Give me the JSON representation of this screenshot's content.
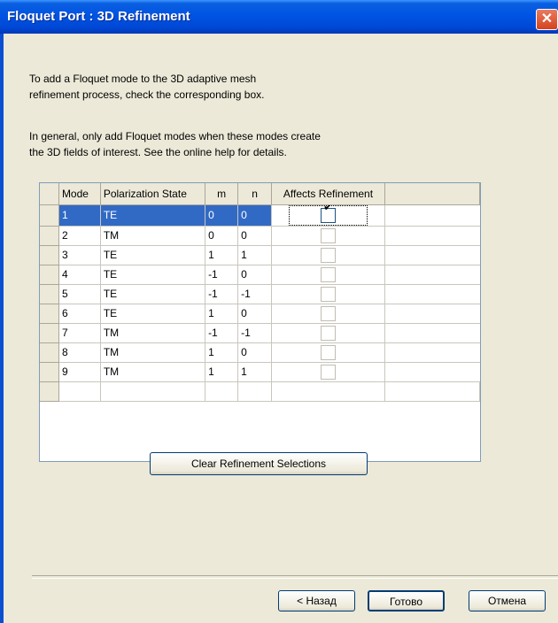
{
  "window": {
    "title": "Floquet Port : 3D Refinement",
    "close_glyph": "✕"
  },
  "intro": {
    "line1": "To add a Floquet mode to the 3D adaptive mesh",
    "line2": "refinement process, check the corresponding box.",
    "line3": "In general, only add Floquet modes when these modes create",
    "line4": "the 3D fields of interest.  See the online help for details."
  },
  "table": {
    "columns": [
      "Mode",
      "Polarization State",
      "m",
      "n",
      "Affects Refinement"
    ],
    "rows": [
      {
        "mode": "1",
        "polarization": "TE",
        "m": "0",
        "n": "0",
        "affects": true,
        "selected": true
      },
      {
        "mode": "2",
        "polarization": "TM",
        "m": "0",
        "n": "0",
        "affects": false,
        "selected": false
      },
      {
        "mode": "3",
        "polarization": "TE",
        "m": "1",
        "n": "1",
        "affects": false,
        "selected": false
      },
      {
        "mode": "4",
        "polarization": "TE",
        "m": "-1",
        "n": "0",
        "affects": false,
        "selected": false
      },
      {
        "mode": "5",
        "polarization": "TE",
        "m": "-1",
        "n": "-1",
        "affects": false,
        "selected": false
      },
      {
        "mode": "6",
        "polarization": "TE",
        "m": "1",
        "n": "0",
        "affects": false,
        "selected": false
      },
      {
        "mode": "7",
        "polarization": "TM",
        "m": "-1",
        "n": "-1",
        "affects": false,
        "selected": false
      },
      {
        "mode": "8",
        "polarization": "TM",
        "m": "1",
        "n": "0",
        "affects": false,
        "selected": false
      },
      {
        "mode": "9",
        "polarization": "TM",
        "m": "1",
        "n": "1",
        "affects": false,
        "selected": false
      }
    ]
  },
  "buttons": {
    "clear": "Clear Refinement Selections",
    "back": "< Назад",
    "finish": "Готово",
    "cancel": "Отмена"
  },
  "scrollbar": {
    "up_glyph": "▲",
    "down_glyph": "▼",
    "thumb_grip": "≡"
  },
  "colors": {
    "titlebar": "#0054e3",
    "selection": "#316ac5",
    "dialog_bg": "#ece9d8"
  }
}
